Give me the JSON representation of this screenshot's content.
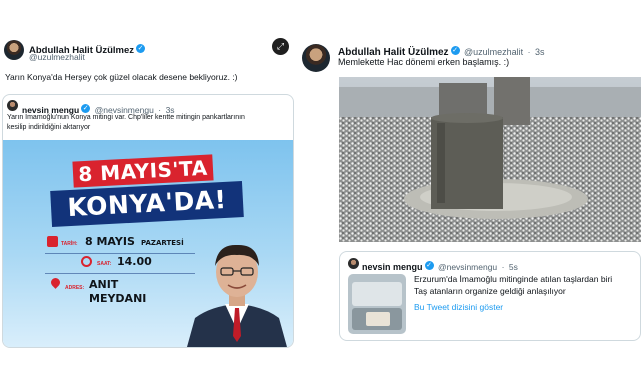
{
  "left_tweet": {
    "author_name": "Abdullah Halit Üzülmez",
    "author_handle": "@uzulmezhalit",
    "text": "Yarın Konya'da Herşey çok güzel olacak desene bekliyoruz. :)",
    "quoted": {
      "author_name": "nevsin mengu",
      "author_handle": "@nevsinmengu",
      "time": "3s",
      "text_line1": "Yarın İmamoğlu'nun Konya mitingi var. Chp'liler kentte mitingin pankartlarının",
      "text_line2": "kesilip indirildiğini aktarıyor",
      "poster": {
        "headline_line1": "8 MAYIS'TA",
        "headline_line2": "KONYA'DA!",
        "date_label": "TARİH:",
        "date_value": "8 MAYIS",
        "date_day": "PAZARTESİ",
        "time_label": "SAAT:",
        "time_value": "14.00",
        "place_label": "ADRES:",
        "place_value_line1": "ANIT",
        "place_value_line2": "MEYDANI"
      }
    }
  },
  "right_tweet": {
    "author_name": "Abdullah Halit Üzülmez",
    "author_handle": "@uzulmezhalit",
    "time": "3s",
    "text": "Memlekette Hac dönemi erken başlamış. :)",
    "quoted": {
      "author_name": "nevsin mengu",
      "author_handle": "@nevsinmengu",
      "time": "5s",
      "text_line1": "Erzurum'da İmamoğlu mitinginde atılan taşlardan biri",
      "text_line2": "Taş atanların organize geldiği anlaşılıyor",
      "thread_link": "Bu Tweet dizisini göster"
    }
  },
  "colors": {
    "accent": "#1d9bf0",
    "brand_red": "#d9232e",
    "brand_navy": "#12337a"
  },
  "icons": {
    "verified": "verified-badge-icon",
    "expand": "expand-icon"
  }
}
